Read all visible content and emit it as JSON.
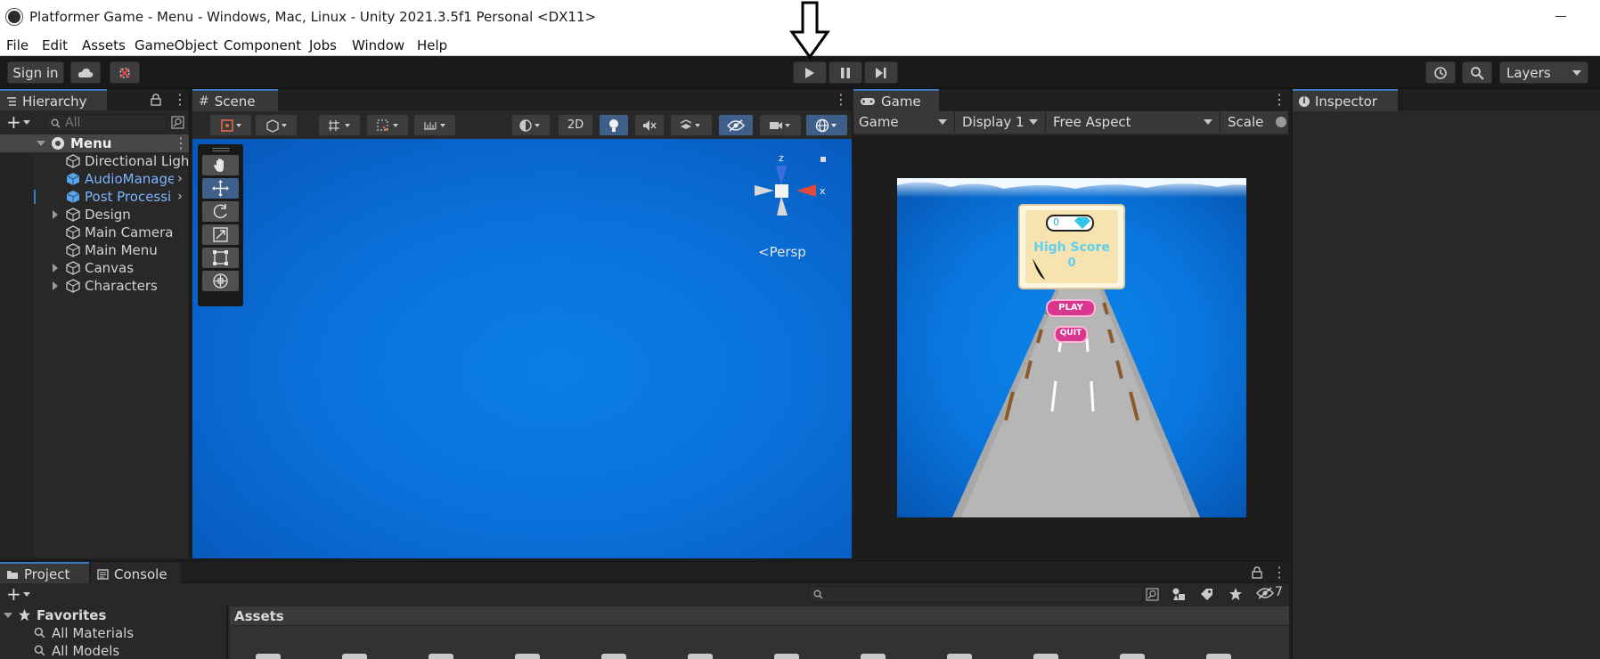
{
  "window": {
    "title": "Platformer Game - Menu - Windows, Mac, Linux - Unity 2021.3.5f1 Personal <DX11>"
  },
  "menu": [
    "File",
    "Edit",
    "Assets",
    "GameObject",
    "Component",
    "Jobs",
    "Window",
    "Help"
  ],
  "toolbar": {
    "sign_in": "Sign in",
    "layers": "Layers"
  },
  "hierarchy": {
    "tab": "Hierarchy",
    "search_placeholder": "All",
    "root": "Menu",
    "items": [
      {
        "label": "Directional Light",
        "color": "#d2d2d2"
      },
      {
        "label": "AudioManage",
        "color": "#7cb4ff"
      },
      {
        "label": "Post Processi",
        "color": "#7cb4ff"
      },
      {
        "label": "Design",
        "color": "#d2d2d2"
      },
      {
        "label": "Main Camera",
        "color": "#d2d2d2"
      },
      {
        "label": "Main Menu",
        "color": "#d2d2d2"
      },
      {
        "label": "Canvas",
        "color": "#d2d2d2"
      },
      {
        "label": "Characters",
        "color": "#d2d2d2"
      }
    ]
  },
  "scene": {
    "tab": "Scene",
    "mode_2d": "2D",
    "persp": "Persp",
    "gizmo_y": "z",
    "gizmo_x": "x"
  },
  "game": {
    "tab": "Game",
    "mode": "Game",
    "display": "Display 1",
    "aspect": "Free Aspect",
    "scale": "Scale",
    "ui": {
      "gem_count": "0",
      "high_score_label": "High Score",
      "high_score_value": "0",
      "play": "PLAY",
      "quit": "QUIT"
    }
  },
  "inspector": {
    "tab": "Inspector"
  },
  "project": {
    "tab_project": "Project",
    "tab_console": "Console",
    "favorites": "Favorites",
    "favorites_items": [
      "All Materials",
      "All Models"
    ],
    "assets_header": "Assets",
    "hidden_count": "7"
  },
  "colors": {
    "accent": "#3a79bb",
    "scene_blue": "#0a72dc",
    "selected_text": "#7cb4ff"
  }
}
